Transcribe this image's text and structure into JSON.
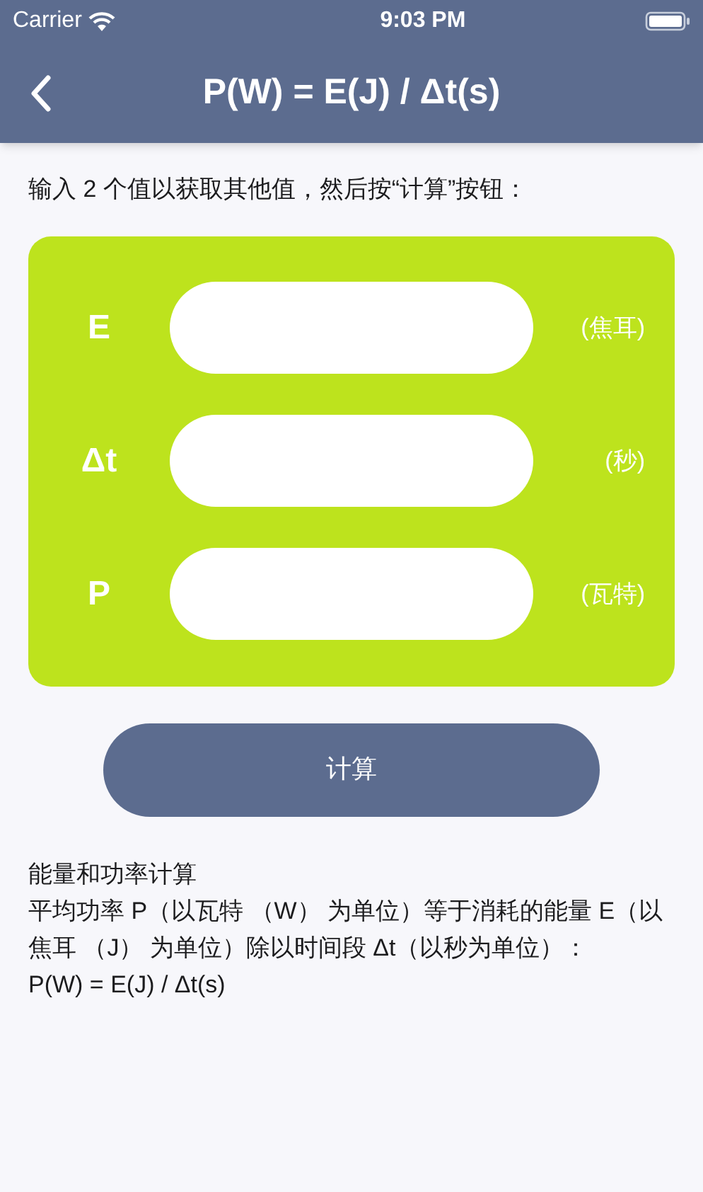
{
  "status_bar": {
    "carrier": "Carrier",
    "time": "9:03 PM"
  },
  "nav_bar": {
    "title": "P(W) = E(J) / Δt(s)"
  },
  "instruction": "输入 2 个值以获取其他值，然后按“计算”按钮：",
  "fields": [
    {
      "label": "E",
      "unit": "(焦耳)"
    },
    {
      "label": "Δt",
      "unit": "(秒)"
    },
    {
      "label": "P",
      "unit": "(瓦特)"
    }
  ],
  "calculate_button": "计算",
  "description": {
    "heading": "能量和功率计算",
    "body": "平均功率 P（以瓦特 （W） 为单位）等于消耗的能量 E（以焦耳 （J） 为单位）除以时间段 Δt（以秒为单位）：",
    "formula": "P(W) = E(J) / Δt(s)"
  }
}
